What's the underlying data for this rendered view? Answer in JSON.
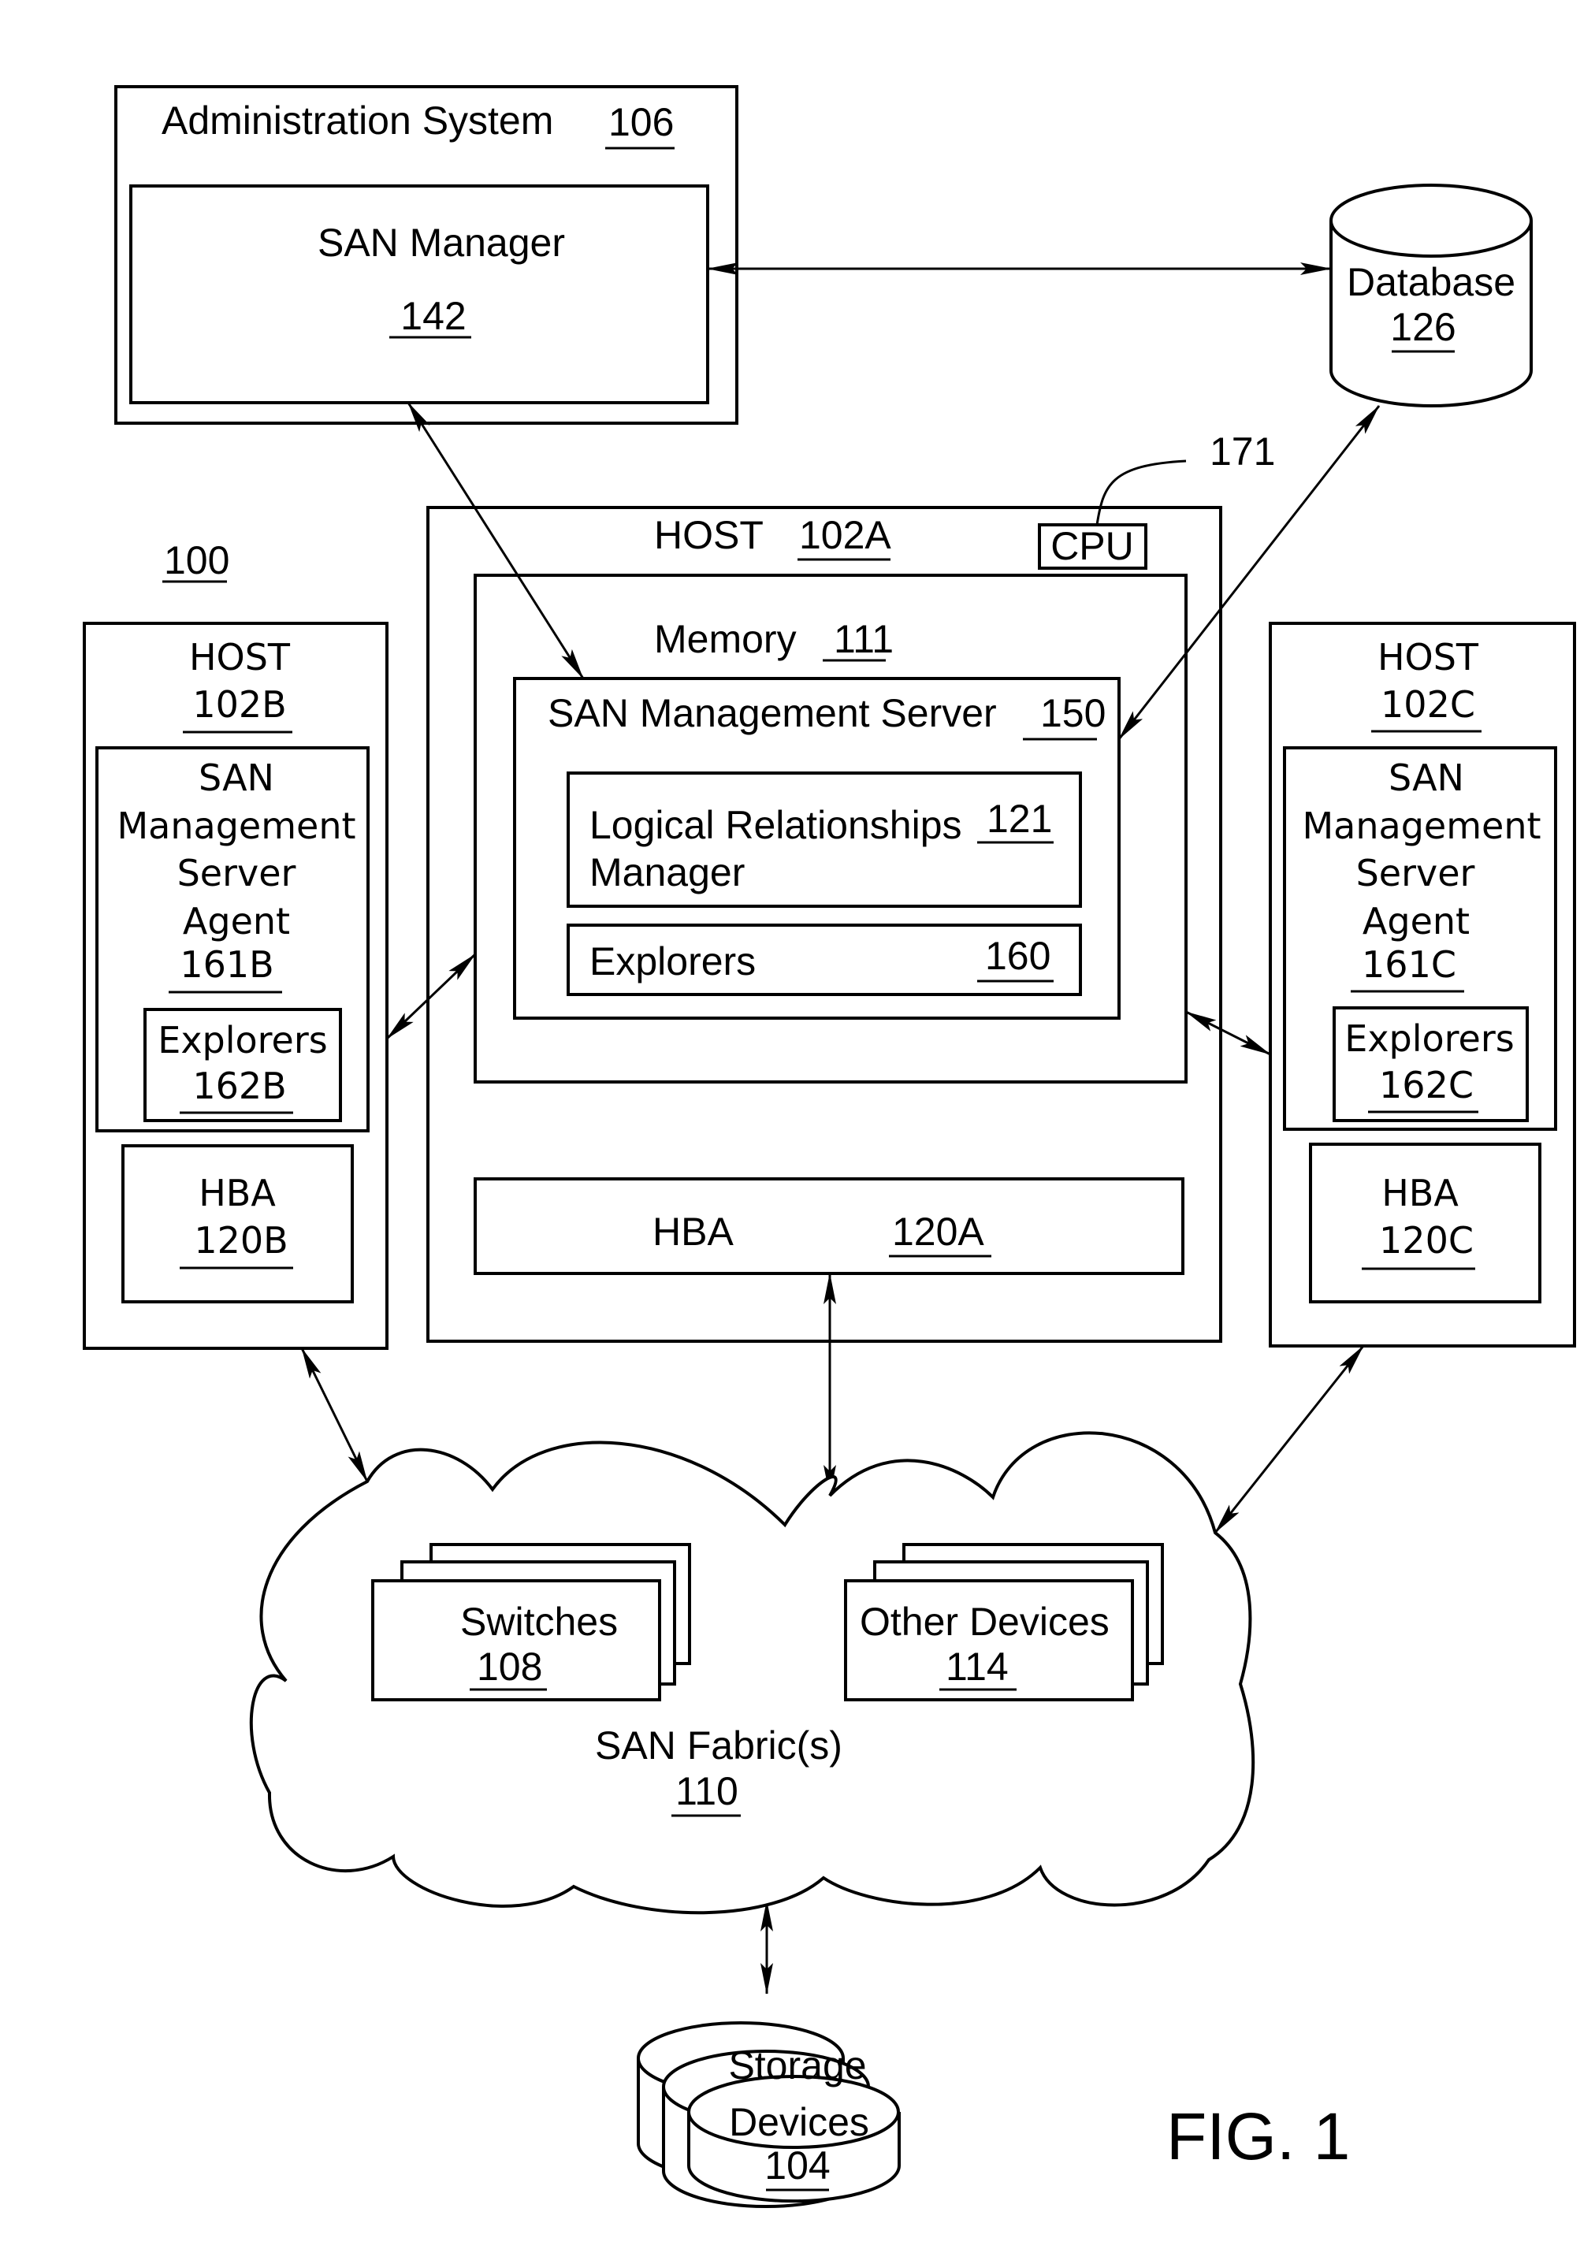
{
  "figure_label": "FIG. 1",
  "system_ref": "100",
  "admin_system": {
    "title": "Administration System",
    "ref": "106",
    "san_manager": {
      "title": "SAN Manager",
      "ref": "142"
    }
  },
  "database": {
    "title": "Database",
    "ref": "126"
  },
  "cpu": {
    "title": "CPU",
    "ref": "171"
  },
  "host_a": {
    "title": "HOST",
    "ref": "102A",
    "memory": {
      "title": "Memory",
      "ref": "111"
    },
    "server": {
      "title": "SAN Management Server",
      "ref": "150"
    },
    "lrm": {
      "line1": "Logical Relationships",
      "line2": "Manager",
      "ref": "121"
    },
    "explorers": {
      "title": "Explorers",
      "ref": "160"
    },
    "hba": {
      "title": "HBA",
      "ref": "120A"
    }
  },
  "host_b": {
    "title": "HOST",
    "ref": "102B",
    "agent": {
      "lines": [
        "SAN",
        "Management",
        "Server",
        "Agent"
      ],
      "ref": "161B"
    },
    "explorers": {
      "title": "Explorers",
      "ref": "162B"
    },
    "hba": {
      "title": "HBA",
      "ref": "120B"
    }
  },
  "host_c": {
    "title": "HOST",
    "ref": "102C",
    "agent": {
      "lines": [
        "SAN",
        "Management",
        "Server",
        "Agent"
      ],
      "ref": "161C"
    },
    "explorers": {
      "title": "Explorers",
      "ref": "162C"
    },
    "hba": {
      "title": "HBA",
      "ref": "120C"
    }
  },
  "fabric": {
    "title": "SAN Fabric(s)",
    "ref": "110",
    "switches": {
      "title": "Switches",
      "ref": "108"
    },
    "other_devices": {
      "title": "Other Devices",
      "ref": "114"
    }
  },
  "storage": {
    "line1": "Storage",
    "line2": "Devices",
    "ref": "104"
  }
}
